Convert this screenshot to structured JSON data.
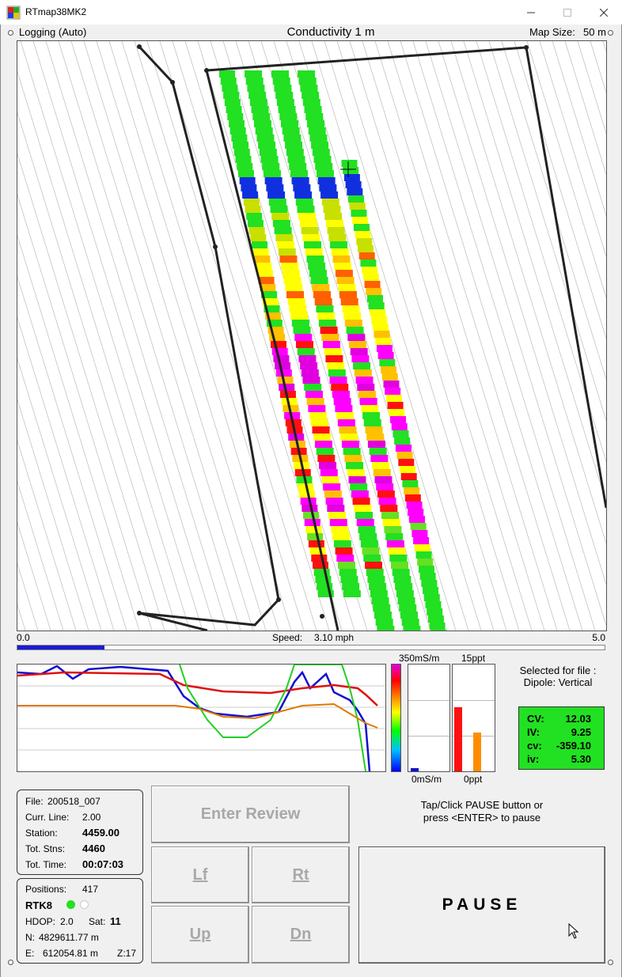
{
  "window": {
    "title": "RTmap38MK2",
    "minimize_icon": "minimize-icon",
    "maximize_icon": "maximize-icon",
    "close_icon": "close-icon"
  },
  "header": {
    "status": "Logging (Auto)",
    "map_title": "Conductivity 1 m",
    "map_size_label": "Map Size:",
    "map_size_value": "50 m"
  },
  "speed": {
    "min_label": "0.0",
    "max_label": "5.0",
    "label": "Speed:",
    "value_text": "3.10 mph",
    "value": 3.1,
    "max": 5.0
  },
  "palette": {
    "top_label": "350mS/m",
    "bottom_label": "0mS/m",
    "ppt_top": "15ppt",
    "ppt_bottom": "0ppt",
    "cond_bar_fraction": 0.03,
    "ppt_bars": [
      0.6,
      0.36
    ],
    "ppt_colors": [
      "#ff1010",
      "#ff8c00"
    ]
  },
  "selection": {
    "line1": "Selected for file :",
    "line2": "Dipole: Vertical"
  },
  "readout": {
    "rows": [
      {
        "key": "CV:",
        "value": "12.03"
      },
      {
        "key": "IV:",
        "value": "9.25"
      },
      {
        "key": "cv:",
        "value": "-359.10"
      },
      {
        "key": "iv:",
        "value": "5.30"
      }
    ],
    "bg_color": "#22e022"
  },
  "file_panel": {
    "file_label": "File:",
    "file_value": "200518_007",
    "curr_line_label": "Curr. Line:",
    "curr_line_value": "2.00",
    "station_label": "Station:",
    "station_value": "4459.00",
    "tot_stns_label": "Tot. Stns:",
    "tot_stns_value": "4460",
    "tot_time_label": "Tot. Time:",
    "tot_time_value": "00:07:03"
  },
  "pos_panel": {
    "positions_label": "Positions:",
    "positions_value": "417",
    "rtk_label": "RTK8",
    "hdop_label": "HDOP:",
    "hdop_value": "2.0",
    "sat_label": "Sat:",
    "sat_value": "11",
    "n_label": "N:",
    "n_value": "4829611.77 m",
    "e_label": "E:",
    "e_value": "612054.81 m",
    "z_label": "Z:17"
  },
  "buttons": {
    "enter_review": "Enter Review",
    "lf": "Lf",
    "rt": "Rt",
    "up": "Up",
    "dn": "Dn",
    "pause": "PAUSE"
  },
  "hint": {
    "line1": "Tap/Click PAUSE button or",
    "line2": "press <ENTER> to pause"
  },
  "trace_colors": {
    "blue": "#1010d0",
    "red": "#e01010",
    "green": "#20d020",
    "orange": "#e07800"
  }
}
